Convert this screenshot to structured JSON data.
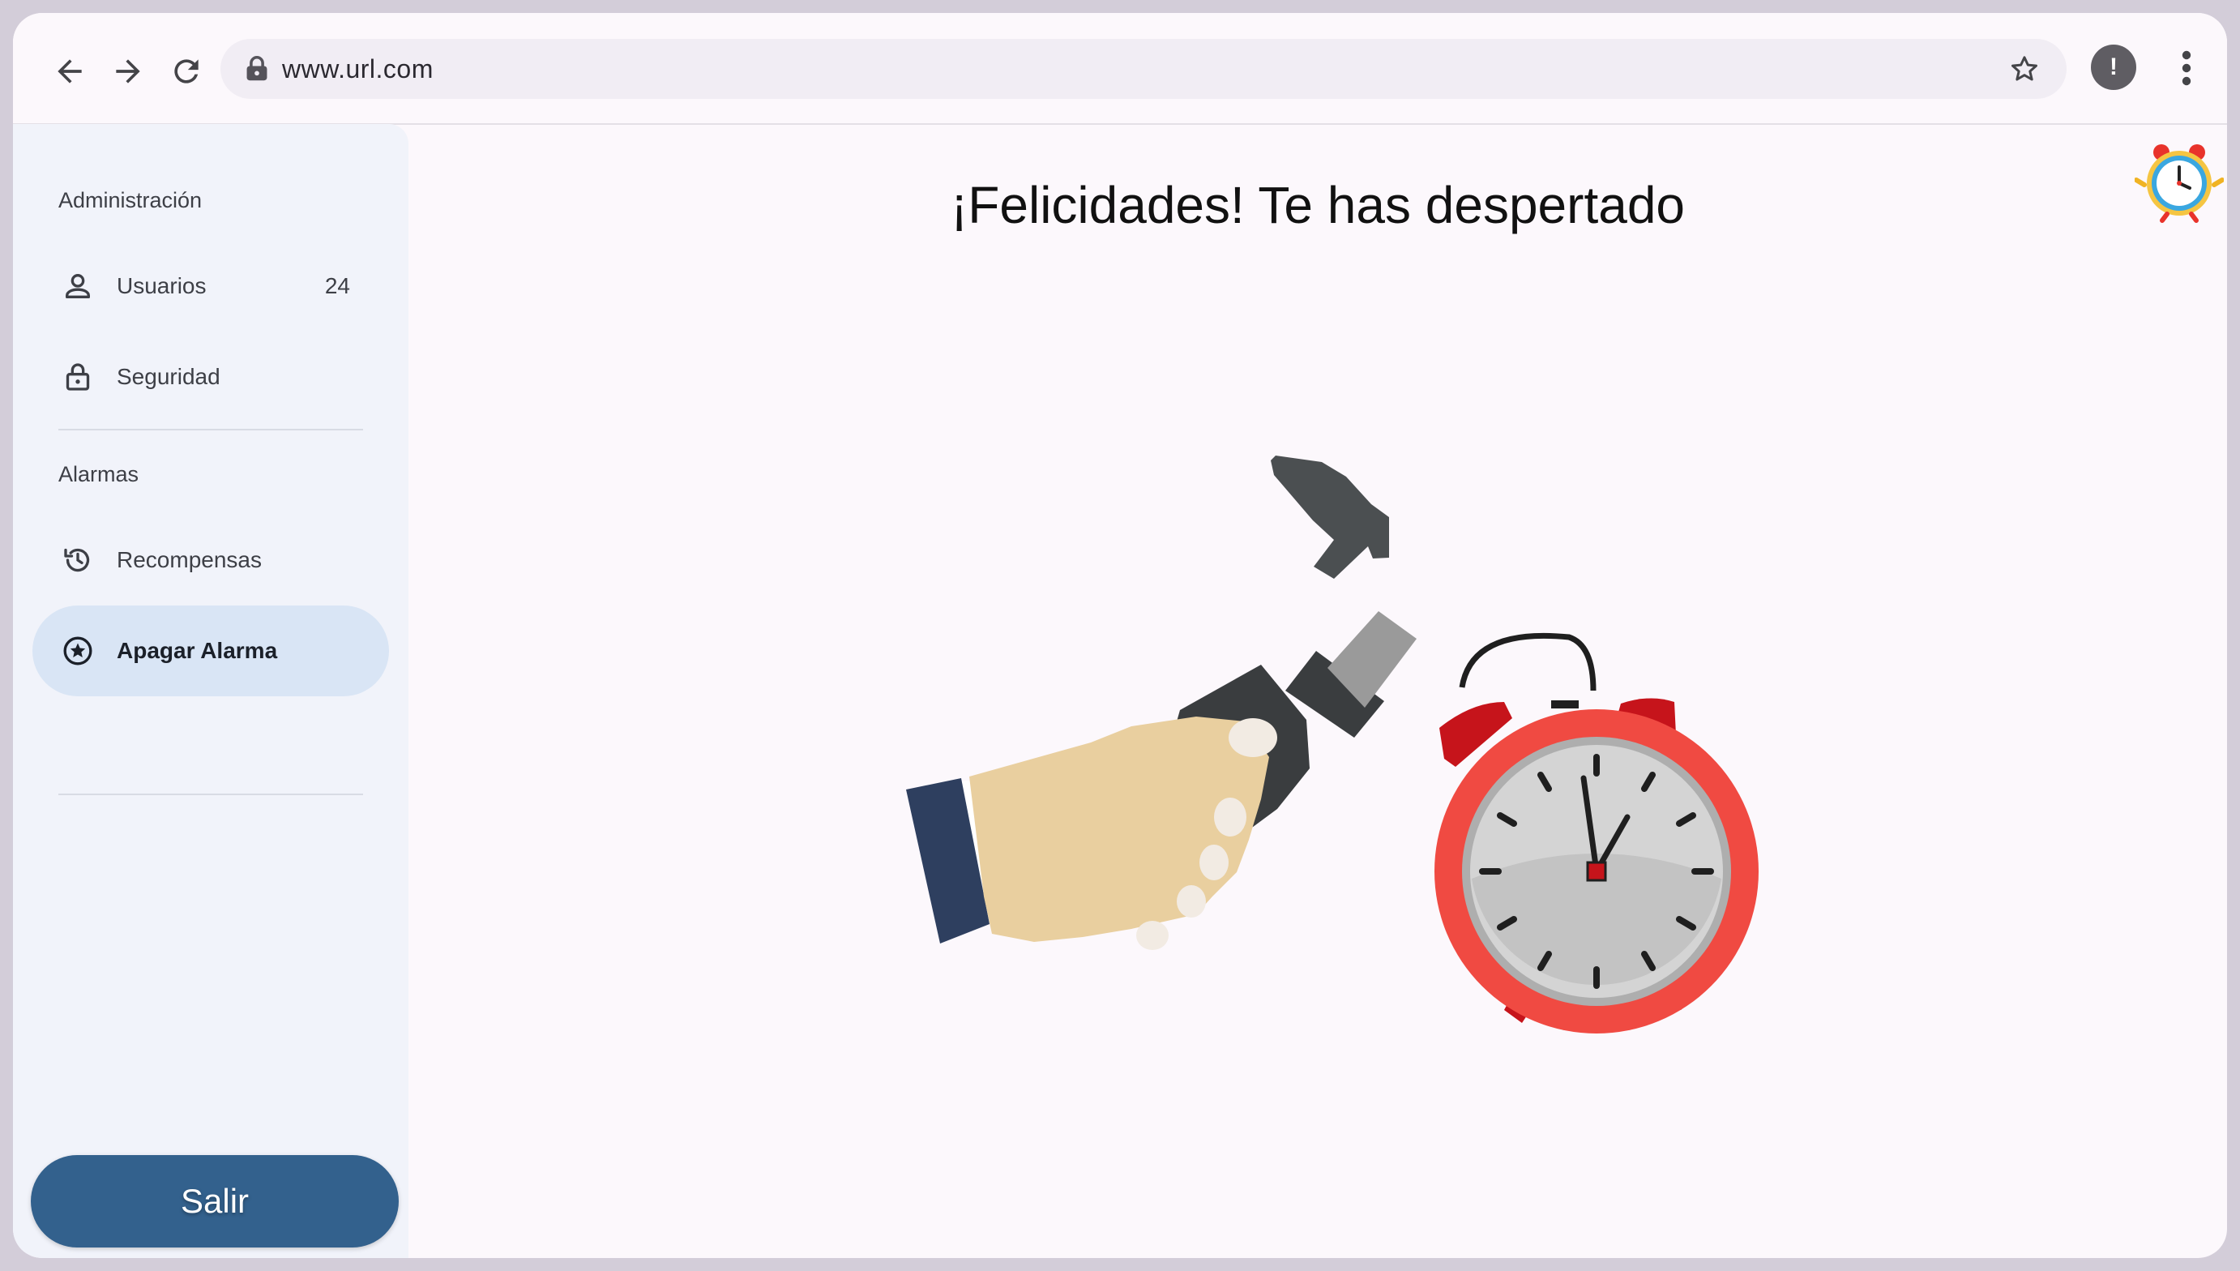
{
  "browser": {
    "url": "www.url.com",
    "profile_badge": "!",
    "icons": [
      "back-arrow-icon",
      "forward-arrow-icon",
      "reload-icon",
      "lock-icon",
      "bookmark-star-icon",
      "kebab-menu-icon"
    ]
  },
  "sidebar": {
    "sections": [
      {
        "label": "Administración",
        "items": [
          {
            "label": "Usuarios",
            "count": "24",
            "icon": "person-icon"
          },
          {
            "label": "Seguridad",
            "icon": "padlock-icon"
          }
        ]
      },
      {
        "label": "Alarmas",
        "items": [
          {
            "label": "Recompensas",
            "icon": "history-icon"
          },
          {
            "label": "Apagar Alarma",
            "icon": "star-circle-icon",
            "active": true
          }
        ]
      }
    ],
    "logout_label": "Salir"
  },
  "main": {
    "title": "¡Felicidades! Te has despertado",
    "illustration": "hand-with-hammer-and-alarm-clock",
    "corner_icon": "alarm-clock-logo-icon"
  },
  "colors": {
    "active_item_bg": "#d9e5f5",
    "logout_button": "#33618d",
    "page_bg": "#fcf8fc",
    "sidebar_bg": "#f1f3fa",
    "clock_red": "#e8332b"
  }
}
